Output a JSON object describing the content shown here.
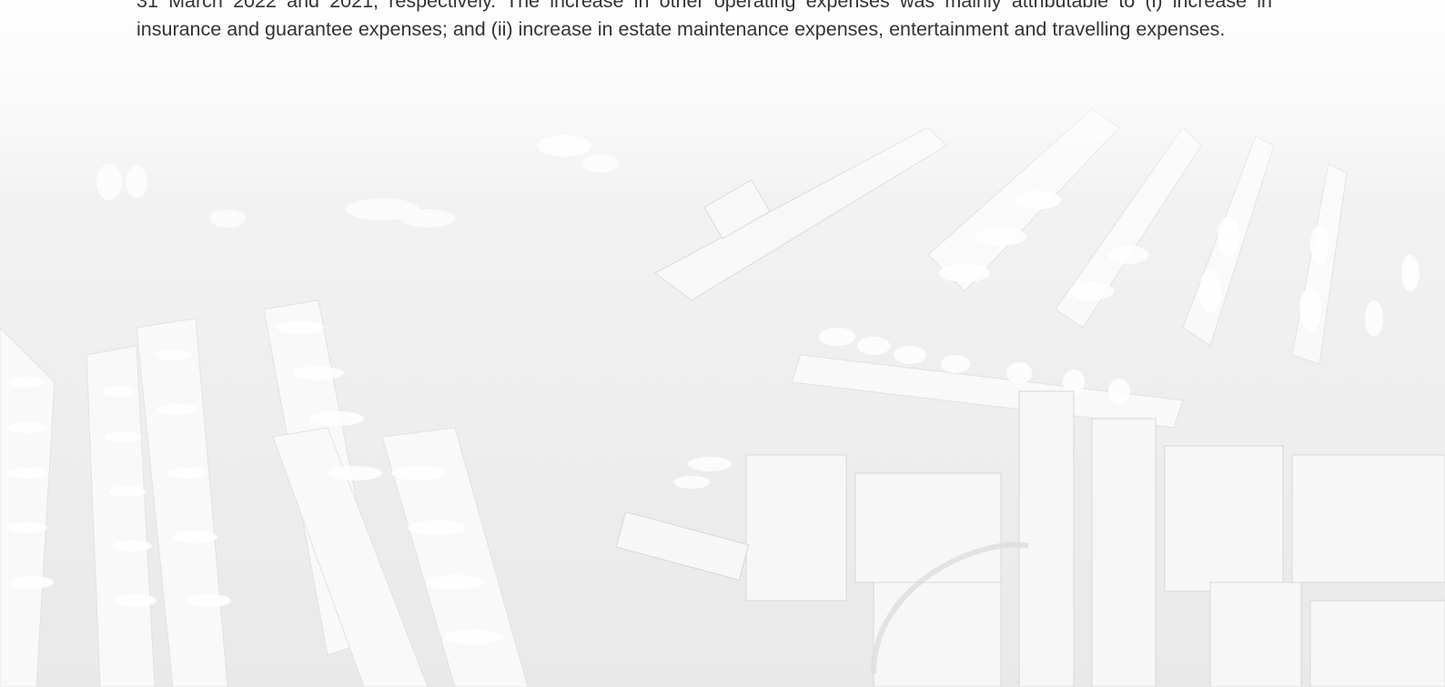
{
  "document": {
    "paragraph_fragment": "31 March 2022 and 2021, respectively. The increase in other operating expenses was mainly attributable to (i) increase in insurance and guarantee expenses; and (ii) increase in estate maintenance expenses, entertainment and travelling expenses."
  },
  "background": {
    "image_description": "aerial-marina-photo",
    "tint": "#f0f0f0"
  }
}
